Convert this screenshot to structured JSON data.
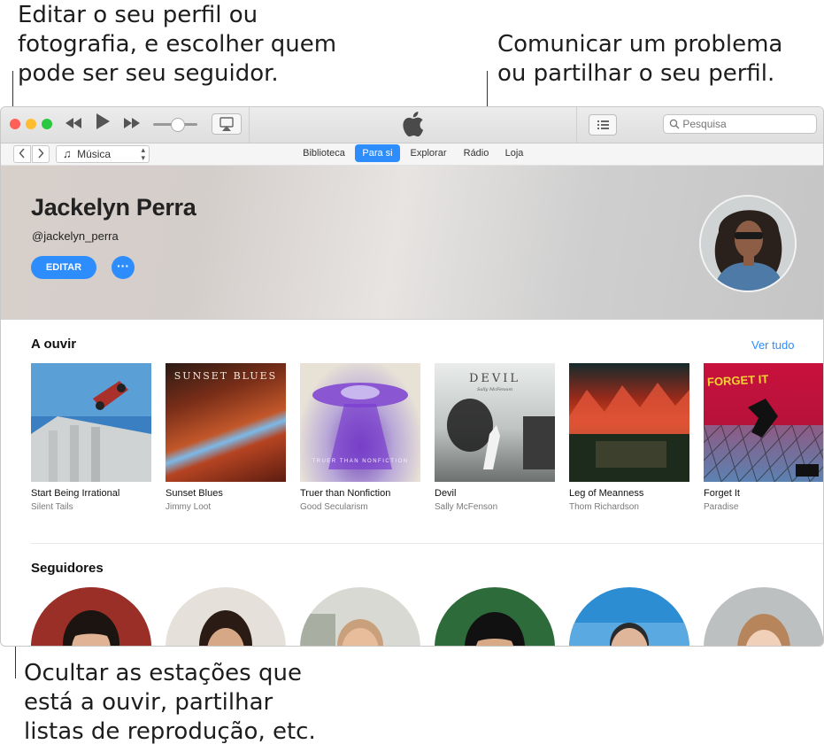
{
  "callouts": {
    "top_left": "Editar o seu perfil ou\nfotografia, e escolher quem\npode ser seu seguidor.",
    "top_right": "Comunicar um problema\nou partilhar o seu perfil.",
    "bottom": "Ocultar as estações que\nestá a ouvir, partilhar\nlistas de reprodução, etc."
  },
  "toolbar": {
    "search_placeholder": "Pesquisa",
    "media_kind": "Música"
  },
  "tabs": [
    {
      "label": "Biblioteca",
      "active": false
    },
    {
      "label": "Para si",
      "active": true
    },
    {
      "label": "Explorar",
      "active": false
    },
    {
      "label": "Rádio",
      "active": false
    },
    {
      "label": "Loja",
      "active": false
    }
  ],
  "profile": {
    "name": "Jackelyn Perra",
    "handle": "@jackelyn_perra",
    "edit_label": "EDITAR",
    "more_label": "···"
  },
  "listening": {
    "title": "A ouvir",
    "see_all": "Ver tudo",
    "albums": [
      {
        "title": "Start Being Irrational",
        "artist": "Silent Tails"
      },
      {
        "title": "Sunset Blues",
        "artist": "Jimmy Loot",
        "art_text": "SUNSET BLUES"
      },
      {
        "title": "Truer than Nonfiction",
        "artist": "Good Secularism",
        "art_text": "TRUER THAN NONFICTION"
      },
      {
        "title": "Devil",
        "artist": "Sally McFenson",
        "art_text": "DEVIL",
        "art_subtext": "Sally McFenson"
      },
      {
        "title": "Leg of Meanness",
        "artist": "Thom Richardson"
      },
      {
        "title": "Forget It",
        "artist": "Paradise",
        "art_text": "FORGET IT"
      }
    ]
  },
  "followers": {
    "title": "Seguidores"
  },
  "colors": {
    "accent": "#2d8dfd",
    "close": "#fe5f57",
    "minimize": "#febc2e",
    "zoom": "#28c840"
  }
}
